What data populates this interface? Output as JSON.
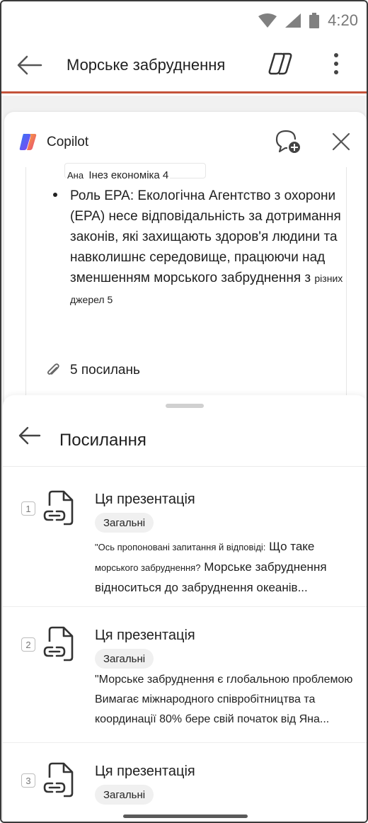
{
  "status_bar": {
    "time": "4:20"
  },
  "app_bar": {
    "title": "Морське забруднення"
  },
  "copilot": {
    "label": "Copilot",
    "snippet_prefix": "Ана",
    "snippet_suffix": "Інез економіка 4",
    "bullet_main": "Роль EPA: Екологічна Агентство з охорони (EPA) несе відповідальність за дотримання законів, які захищають здоров'я людини та навколишнє середовище, працюючи над зменшенням морського забруднення з",
    "bullet_tail": "різних джерел 5",
    "references_count": "5 посилань"
  },
  "references_sheet": {
    "title": "Посилання",
    "items": [
      {
        "number": "1",
        "title": "Ця презентація",
        "badge": "Загальні",
        "snippet_a": "\"Ось пропоновані запитання й відповіді:",
        "snippet_b": "Що таке",
        "snippet_c": "морського забруднення?",
        "snippet_d": "Морське забруднення",
        "snippet_e": "відноситься до забруднення океанів..."
      },
      {
        "number": "2",
        "title": "Ця презентація",
        "badge": "Загальні",
        "snippet_a": "\"Морське забруднення є глобальною проблемою",
        "snippet_b": "Вимагає міжнародного співробітництва та",
        "snippet_c": "координації 80% бере свій початок від Яна..."
      },
      {
        "number": "3",
        "title": "Ця презентація",
        "badge": "Загальні"
      }
    ]
  },
  "icons": {
    "wifi": "wifi-icon",
    "signal": "signal-icon",
    "battery": "battery-icon",
    "back": "arrow-left-icon",
    "copilot_toggle": "copilot-icon",
    "more": "more-vertical-icon",
    "new_chat": "new-chat-icon",
    "close": "close-icon",
    "attachment": "paperclip-icon",
    "document_link": "document-link-icon"
  },
  "colors": {
    "accent": "#c4533a",
    "backdrop": "#f1f1f1"
  }
}
